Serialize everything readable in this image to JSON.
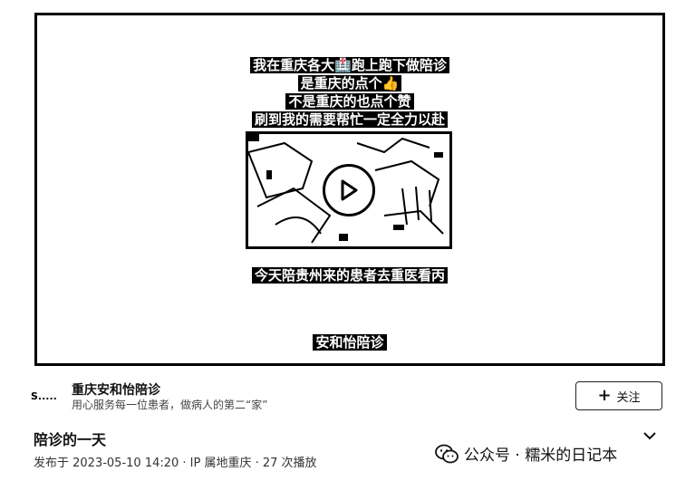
{
  "video": {
    "captions": [
      "我在重庆各大🏥跑上跑下做陪诊",
      "是重庆的点个👍",
      "不是重庆的也点个赞",
      "刷到我的需要帮忙一定全力以赴"
    ],
    "subtitle": "今天陪贵州来的患者去重医看丙",
    "brand_caption": "安和怡陪诊",
    "play_icon": "play-icon"
  },
  "author": {
    "avatar_text": "S.....",
    "name": "重庆安和怡陪诊",
    "description": "用心服务每一位患者，做病人的第二“家”",
    "follow_label": "关注",
    "follow_icon": "plus-icon"
  },
  "post": {
    "title": "陪诊的一天",
    "meta": "发布于 2023-05-10 14:20 · IP 属地重庆 · 27 次播放"
  },
  "watermark": {
    "text": "公众号 · 糯米的日记本",
    "icon": "wechat-icon"
  }
}
